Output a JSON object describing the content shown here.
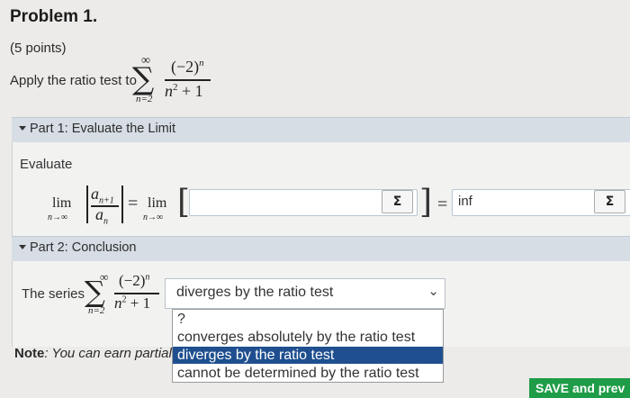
{
  "problem": {
    "title": "Problem 1.",
    "points": "(5 points)",
    "prompt": "Apply the ratio test to",
    "series": {
      "upper": "∞",
      "sigma": "∑",
      "lower": "n=2",
      "numerator": "(−2)",
      "numerator_exp": "n",
      "denominator": "n",
      "denominator_exp": "2",
      "denominator_tail": "+ 1"
    }
  },
  "part1": {
    "header": "Part 1: Evaluate the Limit",
    "evaluate_label": "Evaluate",
    "lim": "lim",
    "lim_sub": "n→∞",
    "frac_num": "a",
    "frac_num_sub": "n+1",
    "frac_den": "a",
    "frac_den_sub": "n",
    "equals": "=",
    "bracket_open": "[",
    "bracket_close": "]",
    "inner_input_value": "",
    "result_value": "inf",
    "sigma_button": "Σ"
  },
  "part2": {
    "header": "Part 2: Conclusion",
    "series_label": "The series",
    "selected_value": "diverges by the ratio test",
    "options": [
      "?",
      "converges absolutely by the ratio test",
      "diverges by the ratio test",
      "cannot be determined by the ratio test"
    ],
    "highlighted_option_index": 2,
    "note_label": "Note",
    "note_text": ": You can earn partial"
  },
  "footer": {
    "save_button": "SAVE and prev"
  },
  "colors": {
    "part_header_bg": "#d6dde4",
    "save_button_bg": "#1f9c47",
    "selected_option_bg": "#1f4f8f"
  }
}
